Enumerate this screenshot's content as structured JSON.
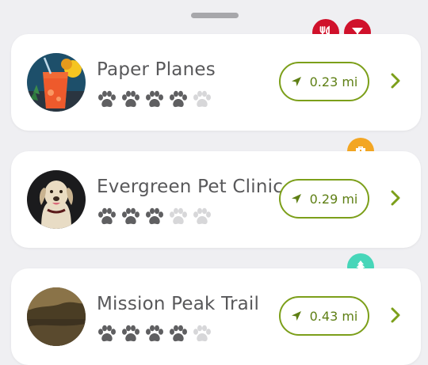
{
  "places": [
    {
      "name": "Paper Planes",
      "paw_rating": 4,
      "paw_max": 5,
      "distance": "0.23 mi",
      "avatar": "cocktail-photo",
      "badges": [
        {
          "icon": "restaurant-icon",
          "color": "#d0112b"
        },
        {
          "icon": "cocktail-icon",
          "color": "#d0112b"
        }
      ]
    },
    {
      "name": "Evergreen Pet Clinic",
      "paw_rating": 3,
      "paw_max": 5,
      "distance": "0.29 mi",
      "avatar": "dog-photo",
      "badges": [
        {
          "icon": "medical-kit-icon",
          "color": "#f3a623"
        }
      ]
    },
    {
      "name": "Mission Peak Trail",
      "paw_rating": 4,
      "paw_max": 5,
      "distance": "0.43 mi",
      "avatar": "landscape-photo",
      "badges": [
        {
          "icon": "tree-icon",
          "color": "#47d6b9"
        }
      ]
    }
  ],
  "colors": {
    "background": "#efeff2",
    "accent_green": "#7c9f1a",
    "paw_filled": "#5f5f61",
    "paw_empty": "#d7d7d9"
  }
}
